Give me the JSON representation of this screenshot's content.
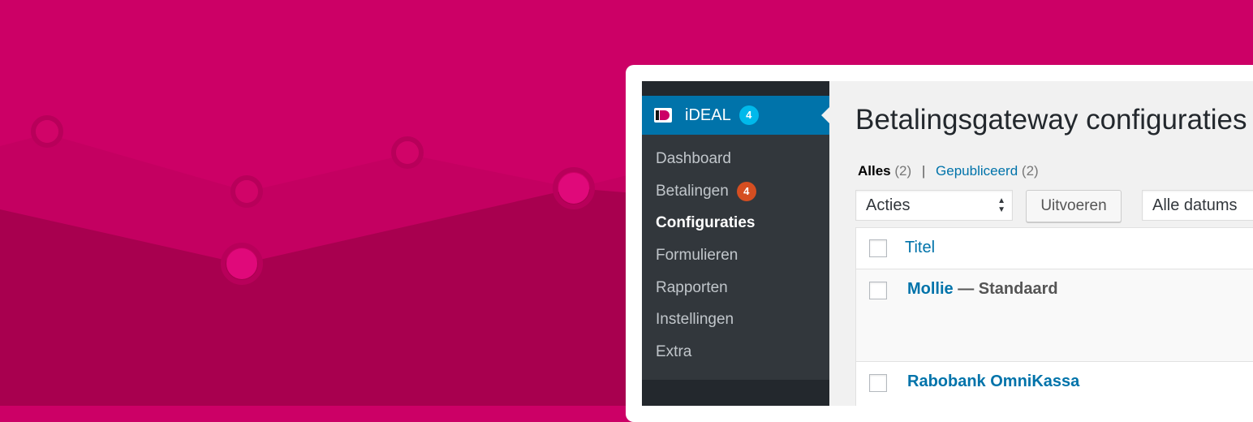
{
  "plugin_menu": {
    "label": "iDEAL",
    "badge": "4",
    "items": [
      {
        "label": "Dashboard"
      },
      {
        "label": "Betalingen",
        "badge": "4"
      },
      {
        "label": "Configuraties",
        "current": true
      },
      {
        "label": "Formulieren"
      },
      {
        "label": "Rapporten"
      },
      {
        "label": "Instellingen"
      },
      {
        "label": "Extra"
      }
    ]
  },
  "page": {
    "title": "Betalingsgateway configuraties",
    "filters": {
      "all_label": "Alles",
      "all_count": "(2)",
      "separator": "|",
      "published_label": "Gepubliceerd",
      "published_count": "(2)"
    },
    "bulk_actions": {
      "selected": "Acties"
    },
    "apply_button": "Uitvoeren",
    "date_filter": {
      "selected": "Alle datums"
    },
    "table": {
      "columns": [
        "Titel"
      ],
      "rows": [
        {
          "title": "Mollie",
          "state": " — Standaard"
        },
        {
          "title": "Rabobank OmniKassa",
          "state": ""
        }
      ]
    }
  },
  "colors": {
    "background": "#cc0066",
    "admin_menu": "#32373c",
    "admin_menu_dark": "#23282d",
    "menu_active": "#0073aa",
    "badge_blue": "#00b9eb",
    "badge_red": "#d54e21",
    "link": "#0073aa"
  },
  "icons": [
    "ideal-logo-icon",
    "select-arrows-icon"
  ]
}
